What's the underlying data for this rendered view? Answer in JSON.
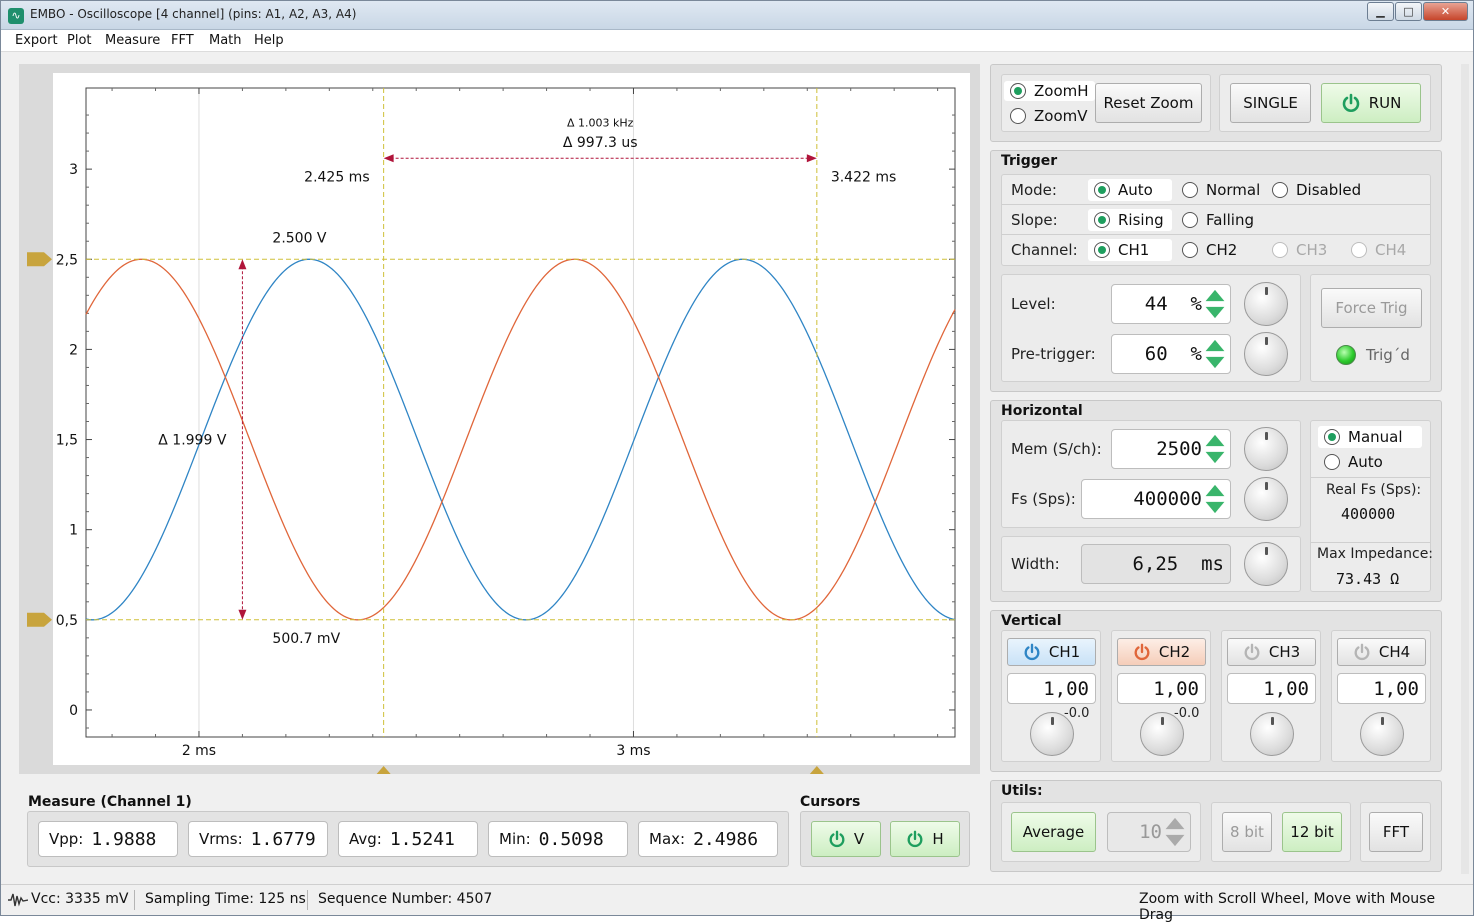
{
  "window": {
    "title": "EMBO - Oscilloscope [4 channel] (pins: A1, A2, A3, A4)",
    "min": "▁",
    "max": "□",
    "close": "✕"
  },
  "menu": [
    "Export",
    "Plot",
    "Measure",
    "FFT",
    "Math",
    "Help"
  ],
  "colors": {
    "ch1": "#2f85c5",
    "ch2": "#e0663a",
    "cursor": "#cfc038",
    "marker": "#c8a43d",
    "delta": "#b0143a",
    "accent_green": "#1e9e5e"
  },
  "plot": {
    "y_ticks": [
      "3",
      "2,5",
      "2",
      "1,5",
      "1",
      "0,5",
      "0"
    ],
    "x_ticks": [
      "2 ms",
      "3 ms"
    ],
    "cursor_v1_label": "2.425 ms",
    "cursor_v2_label": "3.422 ms",
    "freq_label": "Δ 1.003 kHz",
    "dt_label": "Δ 997.3 us",
    "h1_label": "2.500 V",
    "h2_label": "500.7 mV",
    "dv_label": "Δ 1.999 V"
  },
  "chart_data": {
    "type": "line",
    "x_range": [
      1.74,
      3.74
    ],
    "y_range": [
      -0.15,
      3.45
    ],
    "series": [
      {
        "name": "CH1",
        "amplitude": 1.0,
        "offset": 1.5,
        "frequency_khz": 1.003,
        "phase_deg": -3.8
      },
      {
        "name": "CH2",
        "amplitude": 1.0,
        "offset": 1.5,
        "frequency_khz": 1.003,
        "phase_deg": 135.7
      }
    ],
    "cursors": {
      "v1": 2.425,
      "v2": 3.422,
      "h1": 2.5,
      "h2": 0.5007
    }
  },
  "zoom": {
    "h": "ZoomH",
    "v": "ZoomV",
    "reset": "Reset Zoom",
    "single": "SINGLE",
    "run": "RUN"
  },
  "trigger": {
    "title": "Trigger",
    "mode_label": "Mode:",
    "modes": [
      "Auto",
      "Normal",
      "Disabled"
    ],
    "slope_label": "Slope:",
    "slopes": [
      "Rising",
      "Falling"
    ],
    "channel_label": "Channel:",
    "channels": [
      "CH1",
      "CH2",
      "CH3",
      "CH4"
    ],
    "level_label": "Level:",
    "level": "44",
    "level_unit": "%",
    "pretrig_label": "Pre-trigger:",
    "pretrig": "60",
    "pretrig_unit": "%",
    "force": "Force Trig",
    "trigd": "Trig´d"
  },
  "horizontal": {
    "title": "Horizontal",
    "mem_label": "Mem (S/ch):",
    "mem": "2500",
    "fs_label": "Fs (Sps):",
    "fs": "400000",
    "width_label": "Width:",
    "width": "6,25  ms",
    "manual": "Manual",
    "auto": "Auto",
    "real_fs_label": "Real Fs (Sps):",
    "real_fs": "400000",
    "maximp_label": "Max Impedance:",
    "maximp": "73.43 Ω"
  },
  "vertical": {
    "title": "Vertical",
    "channels": [
      {
        "name": "CH1",
        "gain": "1,00",
        "offset": "-0.0"
      },
      {
        "name": "CH2",
        "gain": "1,00",
        "offset": "-0.0"
      },
      {
        "name": "CH3",
        "gain": "1,00",
        "offset": ""
      },
      {
        "name": "CH4",
        "gain": "1,00",
        "offset": ""
      }
    ]
  },
  "utils": {
    "title": "Utils:",
    "average": "Average",
    "avg_count": "10",
    "bit8": "8 bit",
    "bit12": "12 bit",
    "fft": "FFT"
  },
  "measure": {
    "title": "Measure (Channel 1)",
    "items": [
      {
        "label": "Vpp:",
        "value": "1.9888"
      },
      {
        "label": "Vrms:",
        "value": "1.6779"
      },
      {
        "label": "Avg:",
        "value": "1.5241"
      },
      {
        "label": "Min:",
        "value": "0.5098"
      },
      {
        "label": "Max:",
        "value": "2.4986"
      }
    ]
  },
  "cursors": {
    "title": "Cursors",
    "v": "V",
    "h": "H"
  },
  "status": {
    "vcc": "Vcc: 3335 mV",
    "sampling": "Sampling Time: 125 ns",
    "seq": "Sequence Number: 4507",
    "hint": "Zoom with Scroll Wheel, Move with Mouse Drag"
  }
}
